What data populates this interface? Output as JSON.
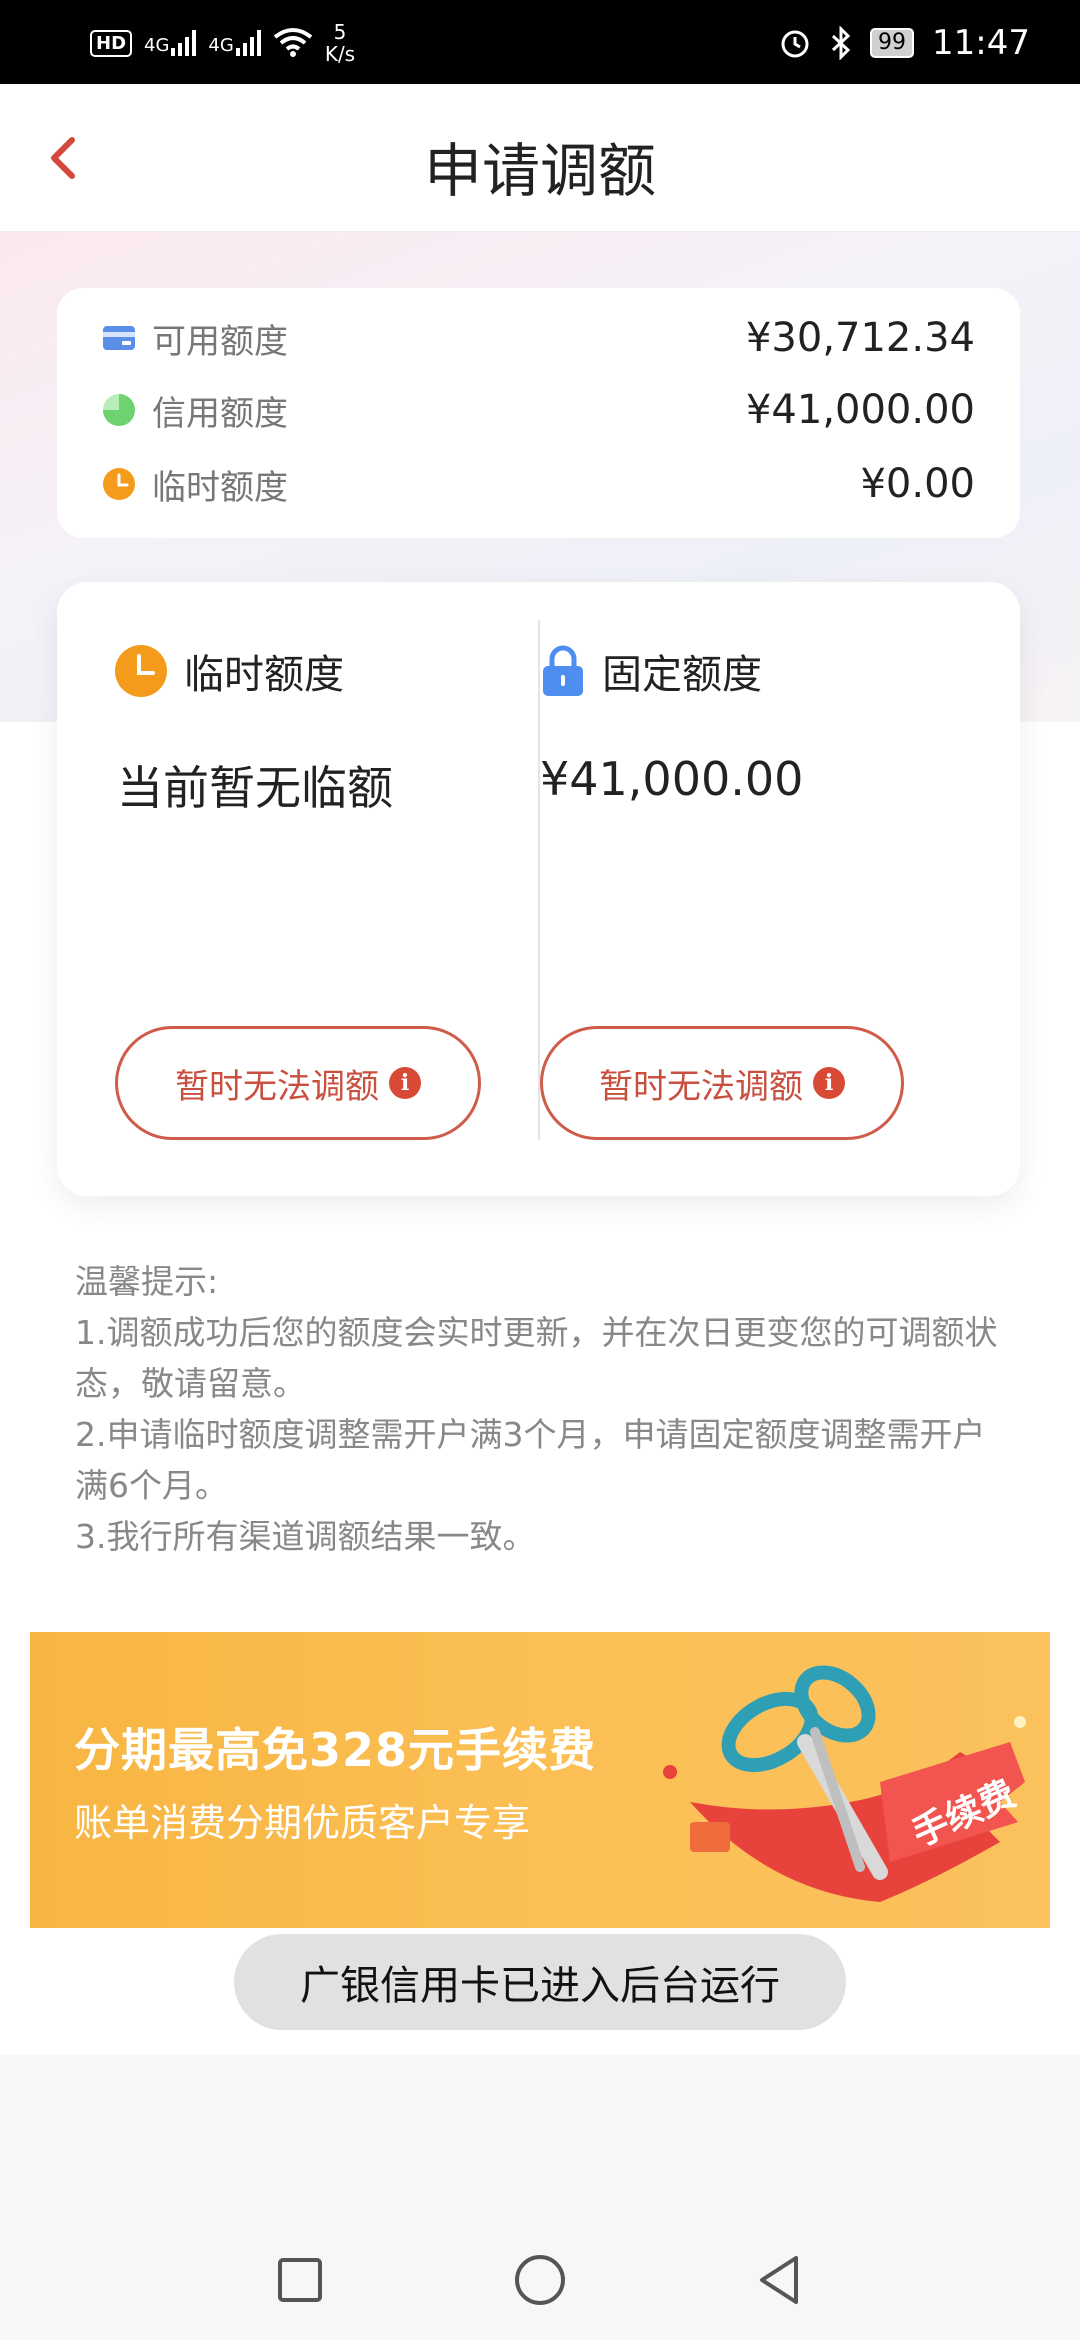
{
  "status_bar": {
    "hd": "HD",
    "net1": "4G",
    "net2": "4G",
    "speed_value": "5",
    "speed_unit": "K/s",
    "battery": "99",
    "time": "11:47"
  },
  "header": {
    "title": "申请调额"
  },
  "summary": {
    "items": [
      {
        "label": "可用额度",
        "value": "¥30,712.34",
        "icon": "card-icon",
        "color": "#5b8ee6"
      },
      {
        "label": "信用额度",
        "value": "¥41,000.00",
        "icon": "pie-icon",
        "color": "#7cd67e"
      },
      {
        "label": "临时额度",
        "value": "¥0.00",
        "icon": "clock-icon",
        "color": "#f59b1c"
      }
    ]
  },
  "temporary": {
    "title": "临时额度",
    "value": "当前暂无临额",
    "button_label": "暂时无法调额"
  },
  "fixed": {
    "title": "固定额度",
    "value": "¥41,000.00",
    "button_label": "暂时无法调额"
  },
  "tips": {
    "heading": "温馨提示:",
    "items": [
      "1.调额成功后您的额度会实时更新，并在次日更变您的可调额状态，敬请留意。",
      "2.申请临时额度调整需开户满3个月，申请固定额度调整需开户满6个月。",
      "3.我行所有渠道调额结果一致。"
    ]
  },
  "banner": {
    "title": "分期最高免328元手续费",
    "subtitle": "账单消费分期优质客户专享",
    "ticket_text": "手续费"
  },
  "toast": {
    "text": "广银信用卡已进入后台运行"
  },
  "colors": {
    "accent": "#cf5b4a",
    "orange": "#f59b1c",
    "blue": "#5b8ee6"
  }
}
